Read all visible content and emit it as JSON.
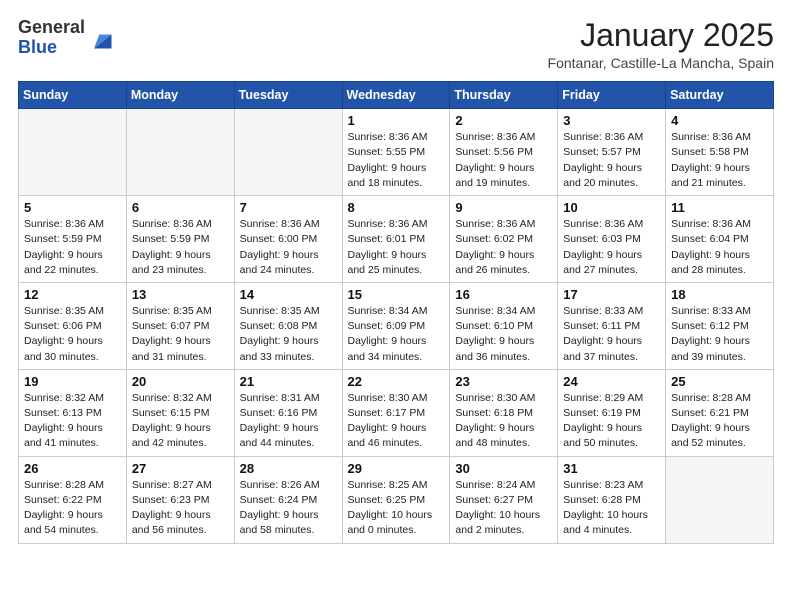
{
  "header": {
    "logo_general": "General",
    "logo_blue": "Blue",
    "month_title": "January 2025",
    "location": "Fontanar, Castille-La Mancha, Spain"
  },
  "columns": [
    "Sunday",
    "Monday",
    "Tuesday",
    "Wednesday",
    "Thursday",
    "Friday",
    "Saturday"
  ],
  "weeks": [
    [
      {
        "day": "",
        "info": ""
      },
      {
        "day": "",
        "info": ""
      },
      {
        "day": "",
        "info": ""
      },
      {
        "day": "1",
        "info": "Sunrise: 8:36 AM\nSunset: 5:55 PM\nDaylight: 9 hours and 18 minutes."
      },
      {
        "day": "2",
        "info": "Sunrise: 8:36 AM\nSunset: 5:56 PM\nDaylight: 9 hours and 19 minutes."
      },
      {
        "day": "3",
        "info": "Sunrise: 8:36 AM\nSunset: 5:57 PM\nDaylight: 9 hours and 20 minutes."
      },
      {
        "day": "4",
        "info": "Sunrise: 8:36 AM\nSunset: 5:58 PM\nDaylight: 9 hours and 21 minutes."
      }
    ],
    [
      {
        "day": "5",
        "info": "Sunrise: 8:36 AM\nSunset: 5:59 PM\nDaylight: 9 hours and 22 minutes."
      },
      {
        "day": "6",
        "info": "Sunrise: 8:36 AM\nSunset: 5:59 PM\nDaylight: 9 hours and 23 minutes."
      },
      {
        "day": "7",
        "info": "Sunrise: 8:36 AM\nSunset: 6:00 PM\nDaylight: 9 hours and 24 minutes."
      },
      {
        "day": "8",
        "info": "Sunrise: 8:36 AM\nSunset: 6:01 PM\nDaylight: 9 hours and 25 minutes."
      },
      {
        "day": "9",
        "info": "Sunrise: 8:36 AM\nSunset: 6:02 PM\nDaylight: 9 hours and 26 minutes."
      },
      {
        "day": "10",
        "info": "Sunrise: 8:36 AM\nSunset: 6:03 PM\nDaylight: 9 hours and 27 minutes."
      },
      {
        "day": "11",
        "info": "Sunrise: 8:36 AM\nSunset: 6:04 PM\nDaylight: 9 hours and 28 minutes."
      }
    ],
    [
      {
        "day": "12",
        "info": "Sunrise: 8:35 AM\nSunset: 6:06 PM\nDaylight: 9 hours and 30 minutes."
      },
      {
        "day": "13",
        "info": "Sunrise: 8:35 AM\nSunset: 6:07 PM\nDaylight: 9 hours and 31 minutes."
      },
      {
        "day": "14",
        "info": "Sunrise: 8:35 AM\nSunset: 6:08 PM\nDaylight: 9 hours and 33 minutes."
      },
      {
        "day": "15",
        "info": "Sunrise: 8:34 AM\nSunset: 6:09 PM\nDaylight: 9 hours and 34 minutes."
      },
      {
        "day": "16",
        "info": "Sunrise: 8:34 AM\nSunset: 6:10 PM\nDaylight: 9 hours and 36 minutes."
      },
      {
        "day": "17",
        "info": "Sunrise: 8:33 AM\nSunset: 6:11 PM\nDaylight: 9 hours and 37 minutes."
      },
      {
        "day": "18",
        "info": "Sunrise: 8:33 AM\nSunset: 6:12 PM\nDaylight: 9 hours and 39 minutes."
      }
    ],
    [
      {
        "day": "19",
        "info": "Sunrise: 8:32 AM\nSunset: 6:13 PM\nDaylight: 9 hours and 41 minutes."
      },
      {
        "day": "20",
        "info": "Sunrise: 8:32 AM\nSunset: 6:15 PM\nDaylight: 9 hours and 42 minutes."
      },
      {
        "day": "21",
        "info": "Sunrise: 8:31 AM\nSunset: 6:16 PM\nDaylight: 9 hours and 44 minutes."
      },
      {
        "day": "22",
        "info": "Sunrise: 8:30 AM\nSunset: 6:17 PM\nDaylight: 9 hours and 46 minutes."
      },
      {
        "day": "23",
        "info": "Sunrise: 8:30 AM\nSunset: 6:18 PM\nDaylight: 9 hours and 48 minutes."
      },
      {
        "day": "24",
        "info": "Sunrise: 8:29 AM\nSunset: 6:19 PM\nDaylight: 9 hours and 50 minutes."
      },
      {
        "day": "25",
        "info": "Sunrise: 8:28 AM\nSunset: 6:21 PM\nDaylight: 9 hours and 52 minutes."
      }
    ],
    [
      {
        "day": "26",
        "info": "Sunrise: 8:28 AM\nSunset: 6:22 PM\nDaylight: 9 hours and 54 minutes."
      },
      {
        "day": "27",
        "info": "Sunrise: 8:27 AM\nSunset: 6:23 PM\nDaylight: 9 hours and 56 minutes."
      },
      {
        "day": "28",
        "info": "Sunrise: 8:26 AM\nSunset: 6:24 PM\nDaylight: 9 hours and 58 minutes."
      },
      {
        "day": "29",
        "info": "Sunrise: 8:25 AM\nSunset: 6:25 PM\nDaylight: 10 hours and 0 minutes."
      },
      {
        "day": "30",
        "info": "Sunrise: 8:24 AM\nSunset: 6:27 PM\nDaylight: 10 hours and 2 minutes."
      },
      {
        "day": "31",
        "info": "Sunrise: 8:23 AM\nSunset: 6:28 PM\nDaylight: 10 hours and 4 minutes."
      },
      {
        "day": "",
        "info": ""
      }
    ]
  ]
}
